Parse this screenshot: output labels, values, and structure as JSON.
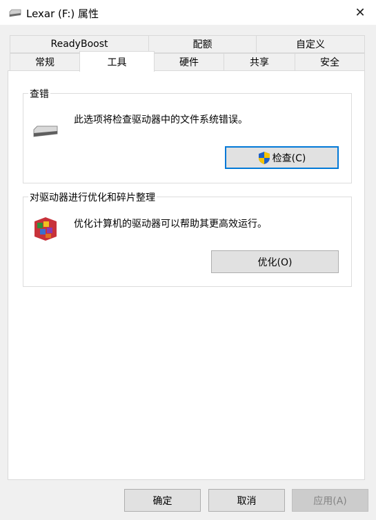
{
  "window": {
    "title": "Lexar (F:) 属性",
    "close_glyph": "✕"
  },
  "tabs_row1": [
    "ReadyBoost",
    "配额",
    "自定义"
  ],
  "tabs_row2": [
    "常规",
    "工具",
    "硬件",
    "共享",
    "安全"
  ],
  "active_tab": "工具",
  "error_check": {
    "group_title": "查错",
    "description": "此选项将检查驱动器中的文件系统错误。",
    "button_label": "检查(C)"
  },
  "optimize": {
    "group_title": "对驱动器进行优化和碎片整理",
    "description": "优化计算机的驱动器可以帮助其更高效运行。",
    "button_label": "优化(O)"
  },
  "footer": {
    "ok": "确定",
    "cancel": "取消",
    "apply": "应用(A)"
  },
  "colors": {
    "accent": "#0078d7",
    "shield_blue": "#1e60c8",
    "shield_yellow": "#f5c400"
  },
  "icons": [
    "drive-icon",
    "close-icon",
    "shield-icon",
    "defrag-icon"
  ]
}
